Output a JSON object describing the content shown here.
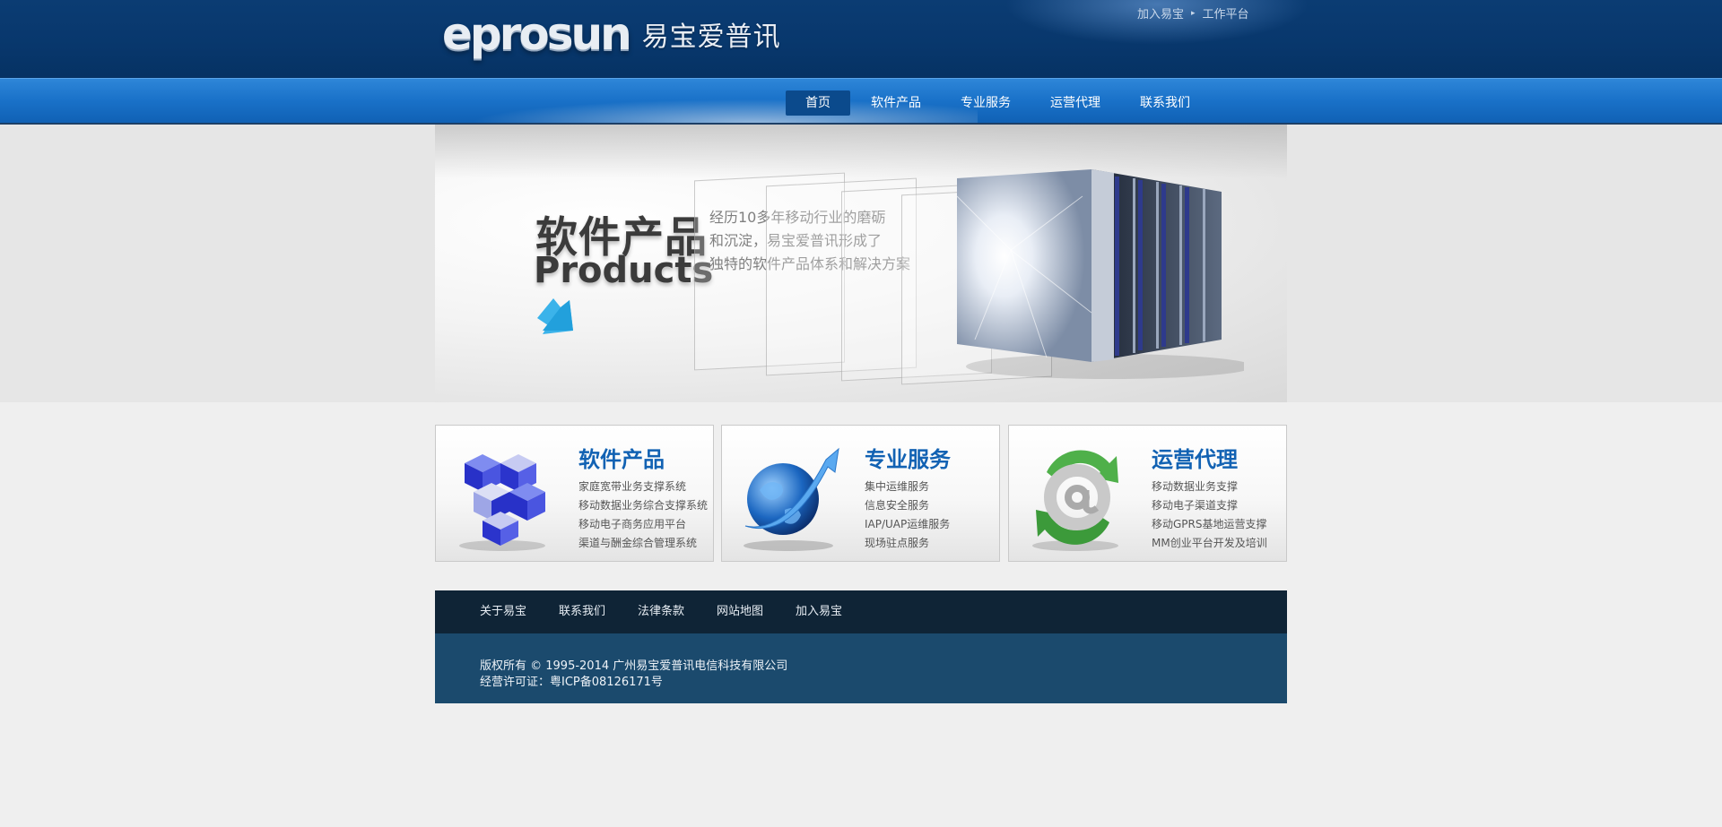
{
  "header": {
    "logo_latin": "eprosun",
    "logo_cn": "易宝爱普讯",
    "top_links": [
      "加入易宝",
      "工作平台"
    ]
  },
  "nav": {
    "items": [
      "首页",
      "软件产品",
      "专业服务",
      "运营代理",
      "联系我们"
    ],
    "active_index": 0
  },
  "banner": {
    "title_cn": "软件产品",
    "title_en": "Products",
    "desc_lines": [
      "经历10多年移动行业的磨砺",
      "和沉淀，易宝爱普讯形成了",
      "独特的软件产品体系和解决方案"
    ]
  },
  "features": [
    {
      "title": "软件产品",
      "icon": "cubes-icon",
      "items": [
        "家庭宽带业务支撑系统",
        "移动数据业务综合支撑系统",
        "移动电子商务应用平台",
        "渠道与酬金综合管理系统"
      ]
    },
    {
      "title": "专业服务",
      "icon": "globe-arrow-icon",
      "items": [
        "集中运维服务",
        "信息安全服务",
        "IAP/UAP运维服务",
        "现场驻点服务"
      ]
    },
    {
      "title": "运营代理",
      "icon": "at-sign-recycle-icon",
      "items": [
        "移动数据业务支撑",
        "移动电子渠道支撑",
        "移动GPRS基地运营支撑",
        "MM创业平台开发及培训"
      ]
    }
  ],
  "footer": {
    "links": [
      "关于易宝",
      "联系我们",
      "法律条款",
      "网站地图",
      "加入易宝"
    ],
    "copyright": "版权所有 © 1995-2014 广州易宝爱普讯电信科技有限公司",
    "license": "经营许可证：粤ICP备08126171号"
  },
  "colors": {
    "header_bg": "#0b3c73",
    "nav_bg": "#1a72c9",
    "nav_active": "#0b4a8c",
    "feature_title": "#1262b3",
    "footer_nav_bg": "#0f2436",
    "footer_info_bg": "#1b4a6d"
  }
}
